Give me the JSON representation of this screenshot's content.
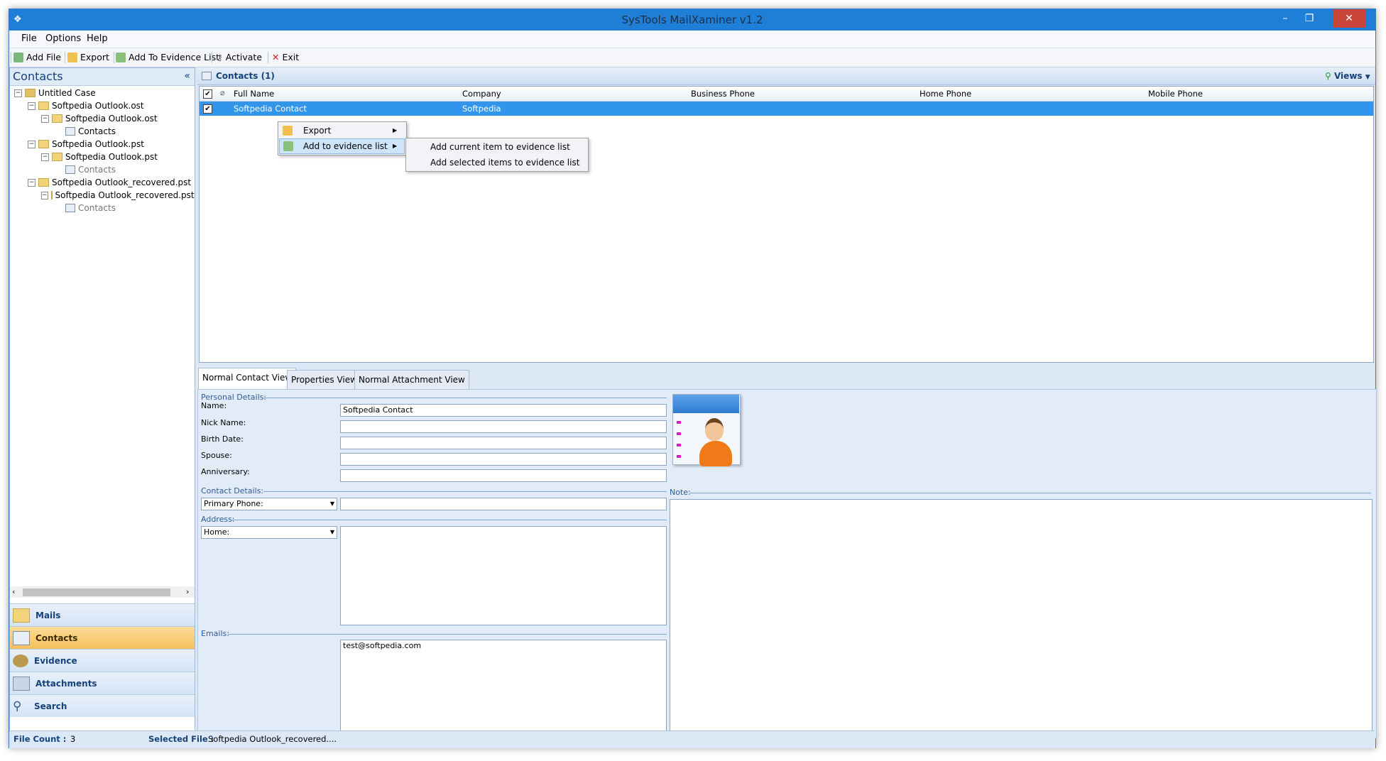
{
  "window": {
    "title": "SysTools MailXaminer v1.2"
  },
  "menubar": {
    "file": "File",
    "options": "Options",
    "help": "Help"
  },
  "toolbar": {
    "add_file": "Add File",
    "export": "Export",
    "add_to_evidence": "Add To Evidence List",
    "activate": "Activate",
    "exit": "Exit"
  },
  "left_pane": {
    "title": "Contacts",
    "collapse": "«",
    "tree": [
      {
        "label": "Untitled Case"
      },
      {
        "label": "Softpedia Outlook.ost"
      },
      {
        "label": "Softpedia Outlook.ost"
      },
      {
        "label": "Contacts"
      },
      {
        "label": "Softpedia Outlook.pst"
      },
      {
        "label": "Softpedia Outlook.pst"
      },
      {
        "label": "Contacts"
      },
      {
        "label": "Softpedia Outlook_recovered.pst"
      },
      {
        "label": "Softpedia Outlook_recovered.pst"
      },
      {
        "label": "Contacts"
      }
    ],
    "nav": [
      {
        "label": "Mails"
      },
      {
        "label": "Contacts"
      },
      {
        "label": "Evidence"
      },
      {
        "label": "Attachments"
      },
      {
        "label": "Search"
      }
    ]
  },
  "contacts_header": {
    "title": "Contacts (1)",
    "views": "Views"
  },
  "grid": {
    "columns": [
      "Full Name",
      "Company",
      "Business Phone",
      "Home Phone",
      "Mobile Phone"
    ],
    "rows": [
      {
        "full_name": "Softpedia Contact",
        "company": "Softpedia",
        "business_phone": "",
        "home_phone": "",
        "mobile_phone": ""
      }
    ]
  },
  "context_menu": {
    "export": "Export",
    "add_to_evidence": "Add to evidence list"
  },
  "submenu": {
    "current": "Add current item to evidence list",
    "selected": "Add selected items to evidence list"
  },
  "tabs": [
    "Normal Contact View",
    "Properties View",
    "Normal Attachment View"
  ],
  "details": {
    "personal_section": "Personal Details:",
    "name_label": "Name:",
    "name_value": "Softpedia Contact",
    "nick_label": "Nick Name:",
    "birth_label": "Birth Date:",
    "spouse_label": "Spouse:",
    "anniv_label": "Anniversary:",
    "contact_section": "Contact Details:",
    "phone_select": "Primary Phone:",
    "address_section": "Address:",
    "address_select": "Home:",
    "emails_section": "Emails:",
    "email_value": "test@softpedia.com",
    "note_section": "Note:"
  },
  "status": {
    "file_count_label": "File Count :",
    "file_count": "3",
    "selected_file_label": "Selected File :",
    "selected_file": "Softpedia Outlook_recovered...."
  },
  "colors": {
    "title_bar": "#1f7fd6",
    "selection": "#3295ec",
    "nav_selected": "#f5c15b",
    "section_text": "#2d5c99"
  }
}
